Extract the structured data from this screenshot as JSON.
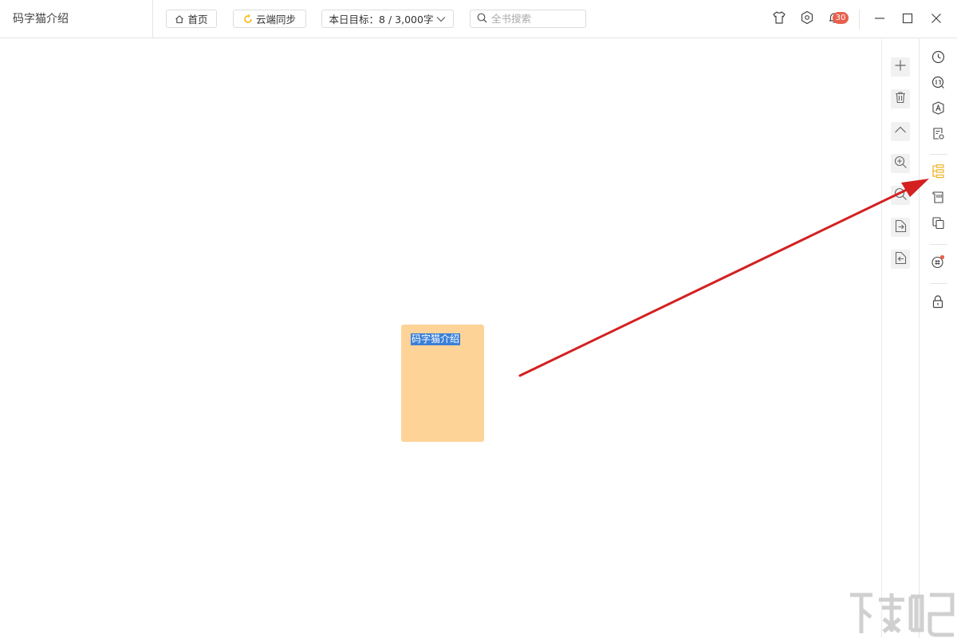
{
  "window": {
    "book_title": "码字猫介绍"
  },
  "toolbar": {
    "home_label": "首页",
    "sync_label": "云端同步",
    "goal_label": "本日目标：8 / 3,000字",
    "search_placeholder": "全书搜索",
    "notification_count": "30"
  },
  "canvas": {
    "card_title": "码字猫介绍",
    "card_color": "#fdd398",
    "selection_color": "#3b7fd8",
    "annotation_arrow_color": "#d42020"
  },
  "icons": {
    "toolbar": [
      "home-icon",
      "sync-icon",
      "chevron-down-icon",
      "search-icon",
      "skin-shirt-icon",
      "settings-icon",
      "bell-icon"
    ],
    "window_controls": [
      "minimize-icon",
      "maximize-icon",
      "close-icon"
    ],
    "canvas_tools": [
      "plus-icon",
      "trash-icon",
      "chevron-up-icon",
      "zoom-in-icon",
      "zoom-out-icon",
      "export-icon",
      "import-icon"
    ],
    "right_sidebar": [
      "history-clock-icon",
      "stats-icon",
      "spellcheck-icon",
      "note-icon",
      "outline-icon",
      "timeline-icon",
      "copy-icon",
      "chat-icon",
      "lock-icon"
    ]
  },
  "colors": {
    "accent_active": "#f0b428",
    "badge": "#e8604c",
    "sync_icon": "#f5b400"
  }
}
